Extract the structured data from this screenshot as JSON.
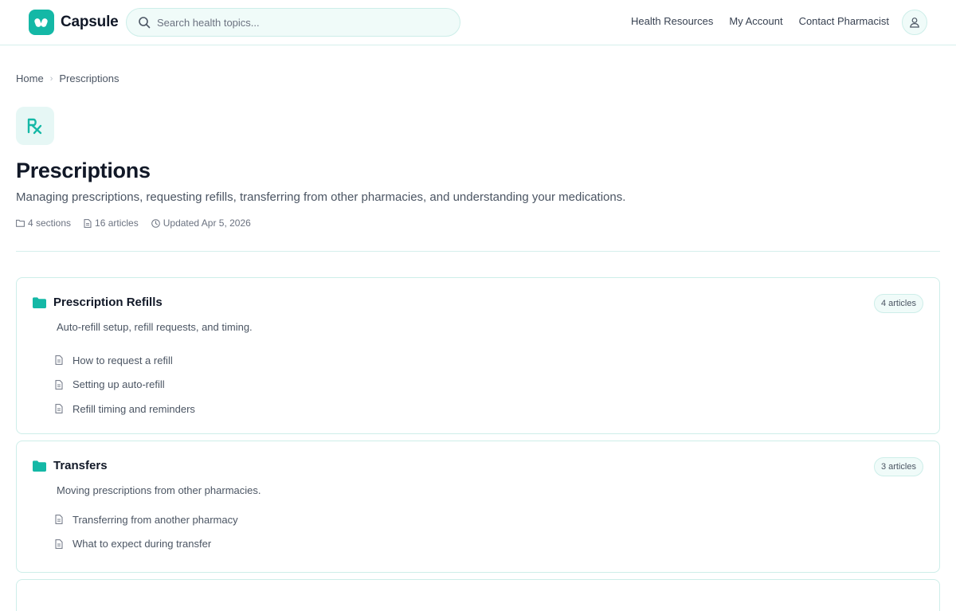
{
  "app": {
    "name": "Capsule"
  },
  "search": {
    "placeholder": "Search health topics..."
  },
  "nav": [
    "Health Resources",
    "My Account",
    "Contact Pharmacist"
  ],
  "breadcrumb": {
    "home": "Home",
    "current": "Prescriptions"
  },
  "category": {
    "title": "Prescriptions",
    "description": "Managing prescriptions, requesting refills, transferring from other pharmacies, and understanding your medications.",
    "sections": "4 sections",
    "articles": "16 articles",
    "updated": "Updated Apr 5, 2026"
  },
  "sections": [
    {
      "title": "Prescription Refills",
      "badge": "4 articles",
      "description": "Auto-refill setup, refill requests, and timing.",
      "articles": [
        "How to request a refill",
        "Setting up auto-refill",
        "Refill timing and reminders"
      ]
    },
    {
      "title": "Transfers",
      "badge": "3 articles",
      "description": "Moving prescriptions from other pharmacies.",
      "articles": [
        "Transferring from another pharmacy",
        "What to expect during transfer"
      ]
    }
  ],
  "colors": {
    "accent": "#14b8a6",
    "accent_light": "#e6f7f5",
    "border": "#cdeee9"
  },
  "icons": [
    "search-icon",
    "user-icon",
    "rx-icon",
    "folder-icon",
    "document-icon",
    "clock-icon"
  ]
}
